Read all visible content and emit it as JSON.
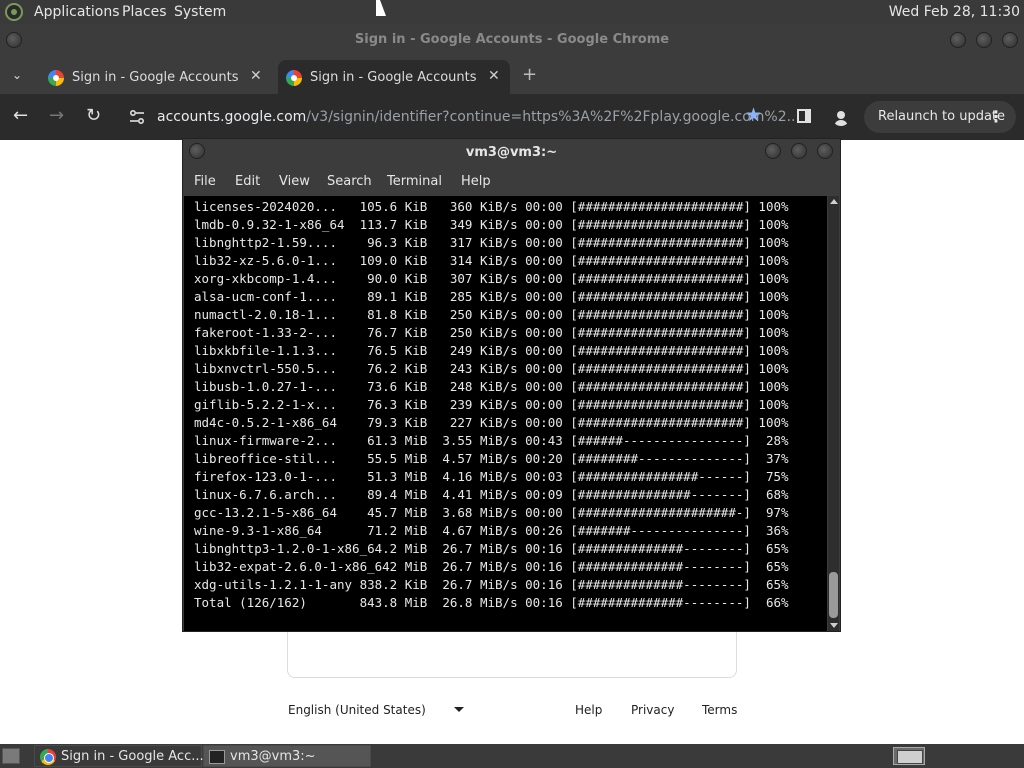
{
  "top_panel": {
    "menus": [
      "Applications",
      "Places",
      "System"
    ],
    "clock": "Wed Feb 28, 11:30"
  },
  "chrome": {
    "window_title": "Sign in - Google Accounts - Google Chrome",
    "tabs": [
      {
        "title": "Sign in - Google Accounts"
      },
      {
        "title": "Sign in - Google Accounts"
      }
    ],
    "url_host": "accounts.google.com",
    "url_path": "/v3/signin/identifier?continue=https%3A%2F%2Fplay.google.com%2...",
    "relaunch_label": "Relaunch to update"
  },
  "page": {
    "footer": {
      "language": "English (United States)",
      "help": "Help",
      "privacy": "Privacy",
      "terms": "Terms"
    }
  },
  "terminal": {
    "title": "vm3@vm3:~",
    "menu": [
      "File",
      "Edit",
      "View",
      "Search",
      "Terminal",
      "Help"
    ],
    "lines": [
      "licenses-2024020...   105.6 KiB   360 KiB/s 00:00 [######################] 100%",
      "lmdb-0.9.32-1-x86_64  113.7 KiB   349 KiB/s 00:00 [######################] 100%",
      "libnghttp2-1.59....    96.3 KiB   317 KiB/s 00:00 [######################] 100%",
      "lib32-xz-5.6.0-1...   109.0 KiB   314 KiB/s 00:00 [######################] 100%",
      "xorg-xkbcomp-1.4...    90.0 KiB   307 KiB/s 00:00 [######################] 100%",
      "alsa-ucm-conf-1....    89.1 KiB   285 KiB/s 00:00 [######################] 100%",
      "numactl-2.0.18-1...    81.8 KiB   250 KiB/s 00:00 [######################] 100%",
      "fakeroot-1.33-2-...    76.7 KiB   250 KiB/s 00:00 [######################] 100%",
      "libxkbfile-1.1.3...    76.5 KiB   249 KiB/s 00:00 [######################] 100%",
      "libxnvctrl-550.5...    76.2 KiB   243 KiB/s 00:00 [######################] 100%",
      "libusb-1.0.27-1-...    73.6 KiB   248 KiB/s 00:00 [######################] 100%",
      "giflib-5.2.2-1-x...    76.3 KiB   239 KiB/s 00:00 [######################] 100%",
      "md4c-0.5.2-1-x86_64    79.3 KiB   227 KiB/s 00:00 [######################] 100%",
      "linux-firmware-2...    61.3 MiB  3.55 MiB/s 00:43 [######----------------]  28%",
      "libreoffice-stil...    55.5 MiB  4.57 MiB/s 00:20 [########--------------]  37%",
      "firefox-123.0-1-...    51.3 MiB  4.16 MiB/s 00:03 [################------]  75%",
      "linux-6.7.6.arch...    89.4 MiB  4.41 MiB/s 00:09 [###############-------]  68%",
      "gcc-13.2.1-5-x86_64    45.7 MiB  3.68 MiB/s 00:00 [#####################-]  97%",
      "wine-9.3-1-x86_64      71.2 MiB  4.67 MiB/s 00:26 [#######---------------]  36%",
      "libnghttp3-1.2.0-1-x86_64.2 MiB  26.7 MiB/s 00:16 [##############--------]  65%",
      "lib32-expat-2.6.0-1-x86_642 MiB  26.7 MiB/s 00:16 [##############--------]  65%",
      "xdg-utils-1.2.1-1-any 838.2 KiB  26.7 MiB/s 00:16 [##############--------]  65%",
      "Total (126/162)       843.8 MiB  26.8 MiB/s 00:16 [##############--------]  66%"
    ]
  },
  "taskbar": {
    "tasks": [
      {
        "label": "Sign in - Google Acc..."
      },
      {
        "label": "vm3@vm3:~"
      }
    ]
  }
}
